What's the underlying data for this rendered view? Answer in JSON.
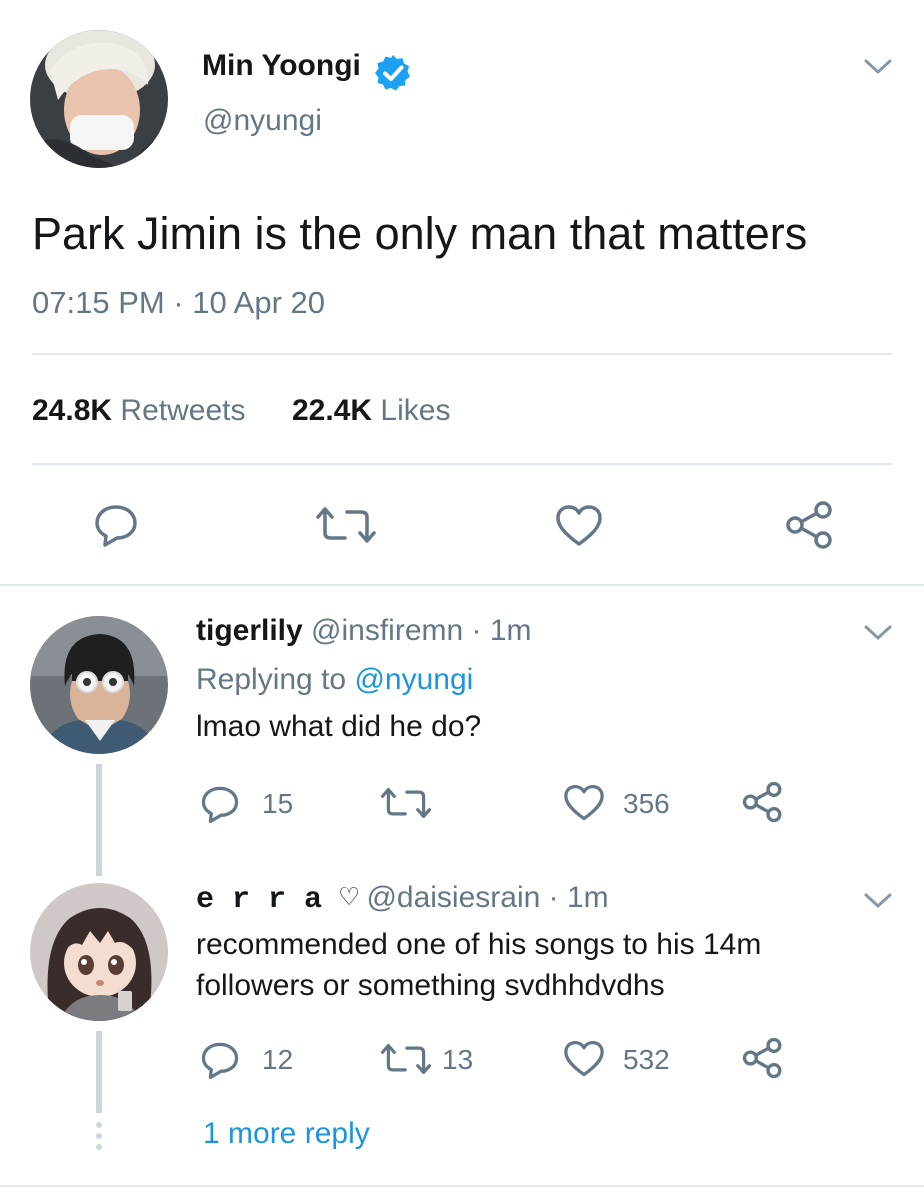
{
  "tweet": {
    "author_name": "Min Yoongi",
    "author_handle": "@nyungi",
    "text": "Park Jimin is the only man that matters",
    "time": "07:15 PM",
    "separator": "·",
    "date": "10 Apr 20",
    "retweets_count": "24.8K",
    "retweets_label": "Retweets",
    "likes_count": "22.4K",
    "likes_label": "Likes",
    "verified_icon": "verified-badge-icon",
    "accent_color": "#1da1f2"
  },
  "replies": [
    {
      "name": "tigerlily",
      "handle": "@insfiremn",
      "time": "· 1m",
      "replying_prefix": "Replying to",
      "replying_to": "@nyungi",
      "text": "lmao what did he do?",
      "reply_count": "15",
      "retweet_count": "",
      "like_count": "356"
    },
    {
      "name": "e r r a ♡",
      "handle": "@daisiesrain",
      "time": "· 1m",
      "text_line1": "recommended one of his songs to his 14m",
      "text_line2": "followers or something svdhhdvdhs",
      "reply_count": "12",
      "retweet_count": "13",
      "like_count": "532"
    }
  ],
  "more_replies": "1 more reply"
}
